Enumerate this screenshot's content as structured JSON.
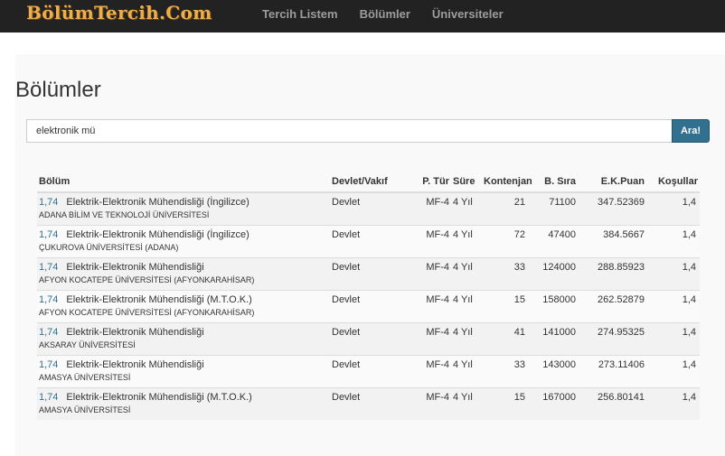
{
  "brand": "BölümTercih.Com",
  "nav": [
    "Tercih Listem",
    "Bölümler",
    "Üniversiteler"
  ],
  "page_title": "Bölümler",
  "search": {
    "value": "elektronik mü",
    "button_label": "Ara!"
  },
  "table": {
    "headers": {
      "bolum": "Bölüm",
      "devlet": "Devlet/Vakıf",
      "ptur": "P. Tür",
      "sure": "Süre",
      "kontenjan": "Kontenjan",
      "bsira": "B. Sıra",
      "ekpuan": "E.K.Puan",
      "kosullar": "Koşullar"
    },
    "rows": [
      {
        "score": "1,74",
        "name": "Elektrik-Elektronik Mühendisliği (İngilizce)",
        "uni": "ADANA BİLİM VE TEKNOLOJİ ÜNİVERSİTESİ",
        "devlet": "Devlet",
        "ptur": "MF-4",
        "sure": "4 Yıl",
        "kontenjan": "21",
        "bsira": "71100",
        "ekpuan": "347.52369",
        "kosullar": "1,4"
      },
      {
        "score": "1,74",
        "name": "Elektrik-Elektronik Mühendisliği (İngilizce)",
        "uni": "ÇUKUROVA ÜNİVERSİTESİ (ADANA)",
        "devlet": "Devlet",
        "ptur": "MF-4",
        "sure": "4 Yıl",
        "kontenjan": "72",
        "bsira": "47400",
        "ekpuan": "384.5667",
        "kosullar": "1,4"
      },
      {
        "score": "1,74",
        "name": "Elektrik-Elektronik Mühendisliği",
        "uni": "AFYON KOCATEPE ÜNİVERSİTESİ (AFYONKARAHİSAR)",
        "devlet": "Devlet",
        "ptur": "MF-4",
        "sure": "4 Yıl",
        "kontenjan": "33",
        "bsira": "124000",
        "ekpuan": "288.85923",
        "kosullar": "1,4"
      },
      {
        "score": "1,74",
        "name": "Elektrik-Elektronik Mühendisliği (M.T.O.K.)",
        "uni": "AFYON KOCATEPE ÜNİVERSİTESİ (AFYONKARAHİSAR)",
        "devlet": "Devlet",
        "ptur": "MF-4",
        "sure": "4 Yıl",
        "kontenjan": "15",
        "bsira": "158000",
        "ekpuan": "262.52879",
        "kosullar": "1,4"
      },
      {
        "score": "1,74",
        "name": "Elektrik-Elektronik Mühendisliği",
        "uni": "AKSARAY ÜNİVERSİTESİ",
        "devlet": "Devlet",
        "ptur": "MF-4",
        "sure": "4 Yıl",
        "kontenjan": "41",
        "bsira": "141000",
        "ekpuan": "274.95325",
        "kosullar": "1,4"
      },
      {
        "score": "1,74",
        "name": "Elektrik-Elektronik Mühendisliği",
        "uni": "AMASYA ÜNİVERSİTESİ",
        "devlet": "Devlet",
        "ptur": "MF-4",
        "sure": "4 Yıl",
        "kontenjan": "33",
        "bsira": "143000",
        "ekpuan": "273.11406",
        "kosullar": "1,4"
      },
      {
        "score": "1,74",
        "name": "Elektrik-Elektronik Mühendisliği (M.T.O.K.)",
        "uni": "AMASYA ÜNİVERSİTESİ",
        "devlet": "Devlet",
        "ptur": "MF-4",
        "sure": "4 Yıl",
        "kontenjan": "15",
        "bsira": "167000",
        "ekpuan": "256.80141",
        "kosullar": "1,4"
      }
    ]
  }
}
